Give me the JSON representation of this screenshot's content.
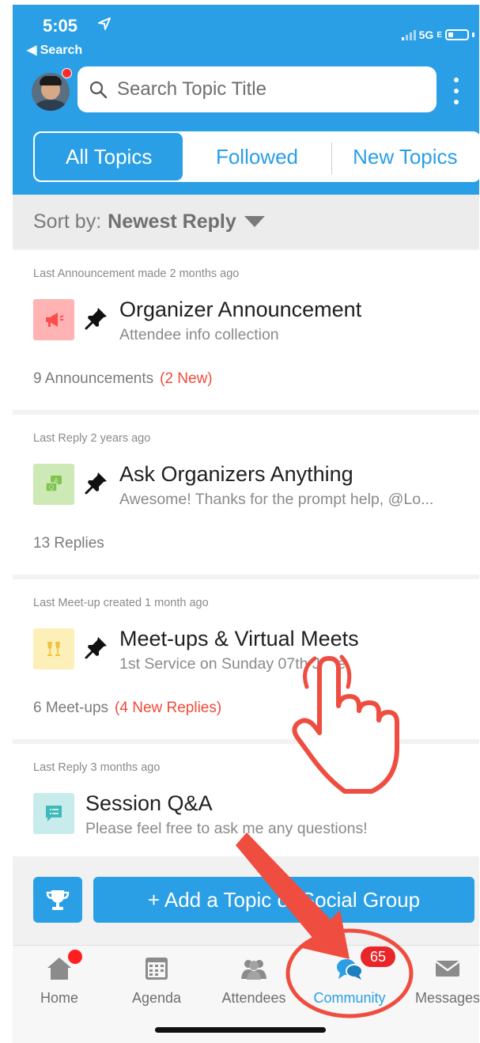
{
  "status_bar": {
    "time": "5:05",
    "back_label": "Search",
    "network": "5G"
  },
  "search": {
    "placeholder": "Search Topic Title"
  },
  "segments": [
    {
      "label": "All Topics",
      "active": true
    },
    {
      "label": "Followed",
      "active": false
    },
    {
      "label": "New Topics",
      "active": false
    }
  ],
  "sort": {
    "prefix": "Sort by:",
    "value": "Newest Reply"
  },
  "topics": [
    {
      "meta": "Last Announcement made 2 months ago",
      "title": "Organizer Announcement",
      "subtitle": "Attendee info collection",
      "count": "9 Announcements",
      "new_label": "(2 New)",
      "icon": "megaphone-icon",
      "icon_bg": "#ffb3b3",
      "icon_color": "#ff4d4d",
      "pinned": true
    },
    {
      "meta": "Last Reply 2 years ago",
      "title": "Ask Organizers Anything",
      "subtitle": "Awesome! Thanks for the prompt help, @Lo...",
      "count": "13 Replies",
      "new_label": "",
      "icon": "qa-icon",
      "icon_bg": "#cde9b6",
      "icon_color": "#7fc24e",
      "pinned": true
    },
    {
      "meta": "Last Meet-up created 1 month ago",
      "title": "Meet-ups & Virtual Meets",
      "subtitle": "1st Service on Sunday 07th June.",
      "count": "6 Meet-ups",
      "new_label": "(4 New Replies)",
      "icon": "toast-icon",
      "icon_bg": "#fdefb8",
      "icon_color": "#f0c23b",
      "pinned": true
    },
    {
      "meta": "Last Reply 3 months ago",
      "title": "Session Q&A",
      "subtitle": "Please feel free to ask me any questions!",
      "count": "",
      "new_label": "",
      "icon": "chat-list-icon",
      "icon_bg": "#c8ecec",
      "icon_color": "#3fb9b9",
      "pinned": false
    }
  ],
  "bottom": {
    "add_label": "+ Add a Topic or Social Group"
  },
  "tabbar": {
    "items": [
      {
        "label": "Home",
        "icon": "home-icon"
      },
      {
        "label": "Agenda",
        "icon": "calendar-icon"
      },
      {
        "label": "Attendees",
        "icon": "people-icon"
      },
      {
        "label": "Community",
        "icon": "community-icon",
        "active": true
      },
      {
        "label": "Messages",
        "icon": "mail-icon"
      }
    ],
    "community_badge": "65"
  },
  "colors": {
    "primary": "#2a9fe6",
    "new_accent": "#f04a3a",
    "badge": "#e8262a",
    "annotation": "#ef4d3f"
  }
}
